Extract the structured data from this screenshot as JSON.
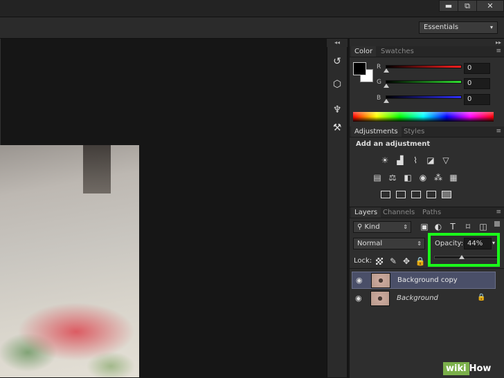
{
  "window": {
    "minimize_glyph": "▬",
    "restore_glyph": "⧉",
    "close_glyph": "✕"
  },
  "workspace": {
    "selected": "Essentials"
  },
  "color_panel": {
    "tabs": [
      "Color",
      "Swatches"
    ],
    "channels": [
      {
        "label": "R",
        "value": "0",
        "color": "#d42a2a"
      },
      {
        "label": "G",
        "value": "0",
        "color": "#3fbf2a"
      },
      {
        "label": "B",
        "value": "0",
        "color": "#2a3fd4"
      }
    ],
    "foreground_color": "#000000",
    "background_color": "#ffffff"
  },
  "adjustments_panel": {
    "tabs": [
      "Adjustments",
      "Styles"
    ],
    "heading": "Add an adjustment"
  },
  "layers_panel": {
    "tabs": [
      "Layers",
      "Channels",
      "Paths"
    ],
    "filter_kind": "Kind",
    "blend_mode": "Normal",
    "opacity_label": "Opacity:",
    "opacity_value": "44%",
    "opacity_fraction": 0.44,
    "lock_label": "Lock:",
    "layers": [
      {
        "name": "Background copy",
        "selected": true
      },
      {
        "name": "Background",
        "selected": false,
        "locked": true
      }
    ]
  },
  "watermark": {
    "wiki": "wiki",
    "how": "How"
  },
  "colors": {
    "highlight": "#1aff1a",
    "panel_bg": "#2e2e2e",
    "app_bg": "#161616"
  }
}
